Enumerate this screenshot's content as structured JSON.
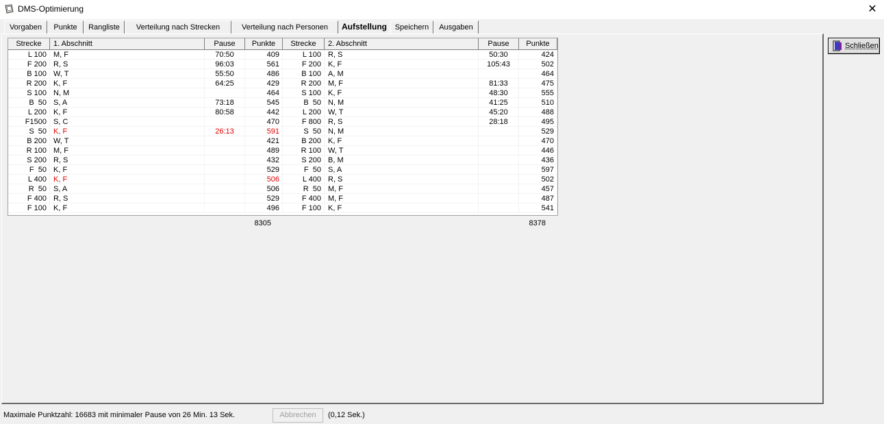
{
  "window": {
    "title": "DMS-Optimierung",
    "close_glyph": "✕"
  },
  "tabs": [
    {
      "label": "Vorgaben"
    },
    {
      "label": "Punkte"
    },
    {
      "label": "Rangliste"
    },
    {
      "label": "Verteilung nach Strecken"
    },
    {
      "label": "Verteilung nach Personen"
    },
    {
      "label": "Aufstellung",
      "active": true
    },
    {
      "label": "Speichern"
    },
    {
      "label": "Ausgaben"
    }
  ],
  "table": {
    "headers": [
      "Strecke",
      "1. Abschnitt",
      "Pause",
      "Punkte",
      "Strecke",
      "2. Abschnitt",
      "Pause",
      "Punkte"
    ],
    "rows": [
      [
        "L 100",
        "M, F",
        "70:50",
        "409",
        "L 100",
        "R, S",
        "50:30",
        "424"
      ],
      [
        "F 200",
        "R, S",
        "96:03",
        "561",
        "F 200",
        "K, F",
        "105:43",
        "502"
      ],
      [
        "B 100",
        "W, T",
        "55:50",
        "486",
        "B 100",
        "A, M",
        "",
        "464"
      ],
      [
        "R 200",
        "K, F",
        "64:25",
        "429",
        "R 200",
        "M, F",
        "81:33",
        "475"
      ],
      [
        "S 100",
        "N, M",
        "",
        "464",
        "S 100",
        "K, F",
        "48:30",
        "555"
      ],
      [
        "B  50",
        "S, A",
        "73:18",
        "545",
        "B  50",
        "N, M",
        "41:25",
        "510"
      ],
      [
        "L 200",
        "K, F",
        "80:58",
        "442",
        "L 200",
        "W, T",
        "45:20",
        "488"
      ],
      [
        "F1500",
        "S, C",
        "",
        "470",
        "F 800",
        "R, S",
        "28:18",
        "495"
      ],
      [
        "S  50",
        "K, F",
        "26:13",
        "591",
        "S  50",
        "N, M",
        "",
        "529"
      ],
      [
        "B 200",
        "W, T",
        "",
        "421",
        "B 200",
        "K, F",
        "",
        "470"
      ],
      [
        "R 100",
        "M, F",
        "",
        "489",
        "R 100",
        "W, T",
        "",
        "446"
      ],
      [
        "S 200",
        "R, S",
        "",
        "432",
        "S 200",
        "B, M",
        "",
        "436"
      ],
      [
        "F  50",
        "K, F",
        "",
        "529",
        "F  50",
        "S, A",
        "",
        "597"
      ],
      [
        "L 400",
        "K, F",
        "",
        "506",
        "L 400",
        "R, S",
        "",
        "502"
      ],
      [
        "R  50",
        "S, A",
        "",
        "506",
        "R  50",
        "M, F",
        "",
        "457"
      ],
      [
        "F 400",
        "R, S",
        "",
        "529",
        "F 400",
        "M, F",
        "",
        "487"
      ],
      [
        "F 100",
        "K, F",
        "",
        "496",
        "F 100",
        "K, F",
        "",
        "541"
      ]
    ],
    "highlight_rows": [
      8,
      13
    ],
    "highlight_color": "#e00000",
    "totals": {
      "first": "8305",
      "second": "8378"
    }
  },
  "side_button": {
    "label": "Schließen",
    "icon": "door-exit-icon"
  },
  "status": {
    "text": "Maximale Punktzahl:  16683 mit minimaler Pause von 26 Min. 13 Sek.",
    "abort_label": "Abbrechen",
    "timing": "(0,12 Sek.)"
  }
}
